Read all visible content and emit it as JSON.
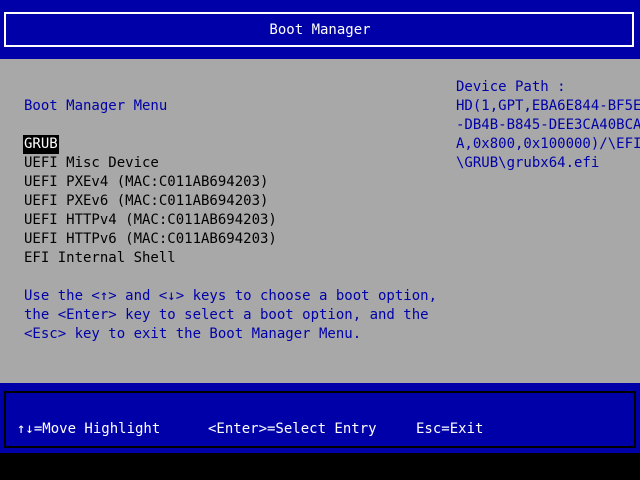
{
  "header": {
    "title": "Boot Manager"
  },
  "menu": {
    "title": "Boot Manager Menu",
    "items": [
      {
        "label": "GRUB",
        "selected": true
      },
      {
        "label": "UEFI Misc Device",
        "selected": false
      },
      {
        "label": "UEFI PXEv4 (MAC:C011AB694203)",
        "selected": false
      },
      {
        "label": "UEFI PXEv6 (MAC:C011AB694203)",
        "selected": false
      },
      {
        "label": "UEFI HTTPv4 (MAC:C011AB694203)",
        "selected": false
      },
      {
        "label": "UEFI HTTPv6 (MAC:C011AB694203)",
        "selected": false
      },
      {
        "label": "EFI Internal Shell",
        "selected": false
      }
    ]
  },
  "help": {
    "lines": [
      "Use the <↑> and <↓> keys to choose a boot option,",
      "the <Enter> key to select a boot option, and the",
      "<Esc> key to exit the Boot Manager Menu."
    ]
  },
  "device_path": {
    "label": "Device Path :",
    "lines": [
      "HD(1,GPT,EBA6E844-BF5E",
      "-DB4B-B845-DEE3CA40BCA",
      "A,0x800,0x100000)/\\EFI",
      "\\GRUB\\grubx64.efi"
    ]
  },
  "footer": {
    "move_hint": "↑↓=Move Highlight",
    "enter_hint": "<Enter>=Select Entry",
    "esc_hint": "Esc=Exit"
  },
  "colors": {
    "background": "#a8a8a8",
    "bar_blue": "#0000a8",
    "text_blue": "#0000a8",
    "text_black": "#000000",
    "text_white": "#ffffff",
    "highlight_bg": "#000000"
  }
}
